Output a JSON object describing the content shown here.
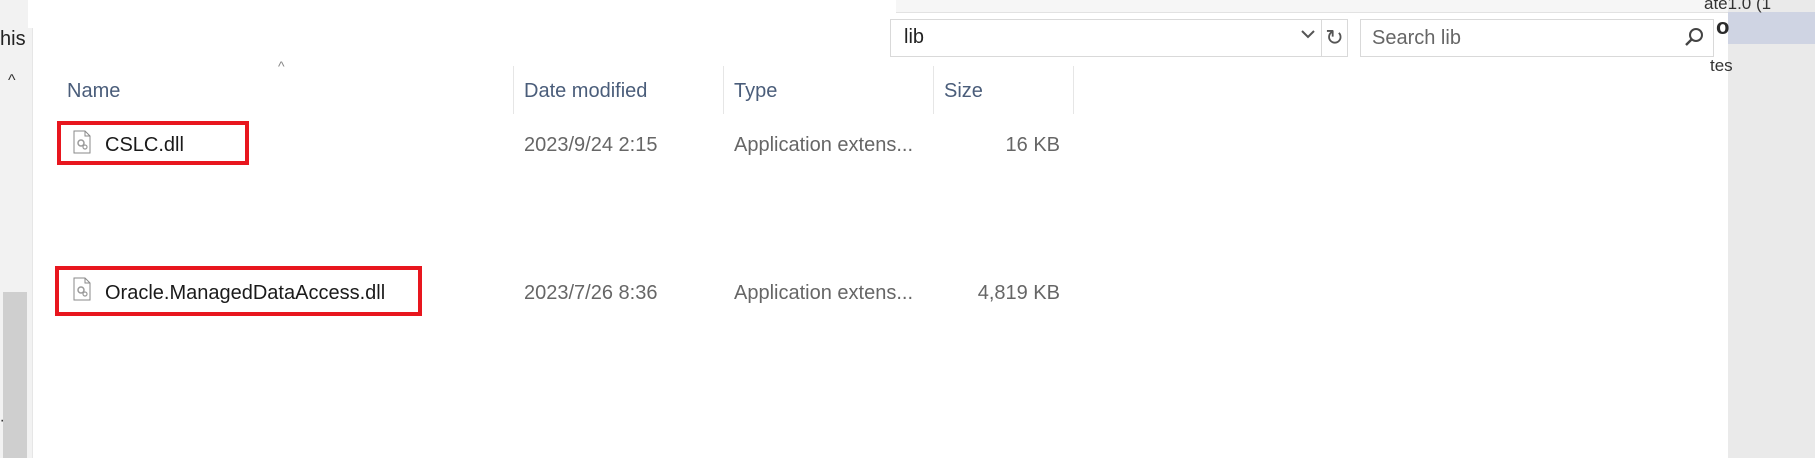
{
  "nav": {
    "text": "his",
    "scroll_up_glyph": "^",
    "bottom_glyph": "∙"
  },
  "address_bar": {
    "path": "lib",
    "dropdown_icon": "chevron-down-icon",
    "refresh_icon": "refresh-icon",
    "refresh_glyph": "↻"
  },
  "search": {
    "placeholder": "Search lib",
    "icon": "search-icon"
  },
  "right_panel": {
    "top_text": "ate1.0 (1",
    "selected_text": "o",
    "item_text": "tes"
  },
  "columns": {
    "name": "Name",
    "date": "Date modified",
    "type": "Type",
    "size": "Size",
    "sort_glyph": "^"
  },
  "files": [
    {
      "name": "CSLC.dll",
      "date": "2023/9/24 2:15",
      "type": "Application extens...",
      "size": "16 KB",
      "highlighted": true
    },
    {
      "name": "Oracle.ManagedDataAccess.dll",
      "date": "2023/7/26 8:36",
      "type": "Application extens...",
      "size": "4,819 KB",
      "highlighted": true
    }
  ],
  "colors": {
    "highlight": "#e8161e",
    "header_text": "#4a5d7a",
    "selected_panel": "#cfd4e3"
  }
}
